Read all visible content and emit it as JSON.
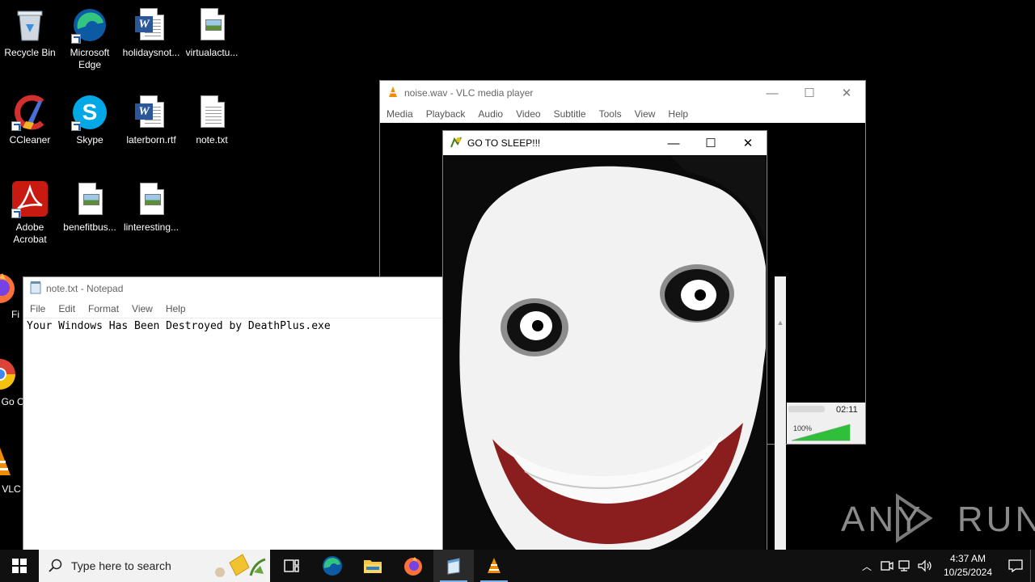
{
  "desktop_icons": [
    {
      "label": "Recycle Bin",
      "icon": "recycle-bin-icon"
    },
    {
      "label": "Microsoft Edge",
      "icon": "edge-icon"
    },
    {
      "label": "holidaysnot...",
      "icon": "word-document-icon"
    },
    {
      "label": "virtualactu...",
      "icon": "image-file-icon"
    },
    {
      "label": "CCleaner",
      "icon": "ccleaner-icon"
    },
    {
      "label": "Skype",
      "icon": "skype-icon"
    },
    {
      "label": "laterborn.rtf",
      "icon": "word-document-icon"
    },
    {
      "label": "note.txt",
      "icon": "text-file-icon"
    },
    {
      "label": "Adobe Acrobat",
      "icon": "acrobat-icon"
    },
    {
      "label": "benefitbus...",
      "icon": "image-file-icon"
    },
    {
      "label": "linteresting...",
      "icon": "image-file-icon"
    },
    {
      "label": "Fi",
      "icon": "firefox-icon"
    },
    {
      "label": "Go Ch",
      "icon": "chrome-icon"
    },
    {
      "label": "VLC p",
      "icon": "vlc-icon"
    }
  ],
  "vlc": {
    "title": "noise.wav - VLC media player",
    "menu": [
      "Media",
      "Playback",
      "Audio",
      "Video",
      "Subtitle",
      "Tools",
      "View",
      "Help"
    ],
    "time": "02:11",
    "volume": "100%",
    "volume_level": 1.0
  },
  "sleep_window": {
    "title": "GO TO SLEEP!!!"
  },
  "notepad": {
    "title": "note.txt - Notepad",
    "menu": [
      "File",
      "Edit",
      "Format",
      "View",
      "Help"
    ],
    "content": "Your Windows Has Been Destroyed by DeathPlus.exe"
  },
  "taskbar": {
    "search_placeholder": "Type here to search",
    "apps": [
      "task-view-icon",
      "edge-icon",
      "file-explorer-icon",
      "firefox-icon",
      "notepad-icon",
      "vlc-icon"
    ],
    "time": "4:37 AM",
    "date": "10/25/2024"
  },
  "watermark": "ANY RUN"
}
